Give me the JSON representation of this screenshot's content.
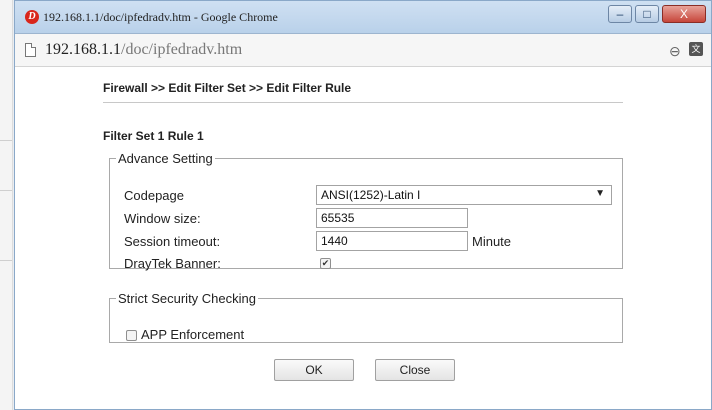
{
  "window": {
    "title": "192.168.1.1/doc/ipfedradv.htm - Google Chrome",
    "logo_letter": "D",
    "minimize": "–",
    "maximize": "□",
    "close": "X"
  },
  "address": {
    "host": "192.168.1.1",
    "path": "/doc/ipfedradv.htm"
  },
  "page": {
    "breadcrumb": "Firewall >> Edit Filter Set >> Edit Filter Rule",
    "set_title": "Filter Set 1 Rule 1"
  },
  "advance": {
    "legend": "Advance Setting",
    "codepage_label": "Codepage",
    "codepage_value": "ANSI(1252)-Latin I",
    "window_size_label": "Window size:",
    "window_size_value": "65535",
    "session_timeout_label": "Session timeout:",
    "session_timeout_value": "1440",
    "session_timeout_unit": "Minute",
    "banner_label": "DrayTek Banner:",
    "banner_checked": true
  },
  "strict": {
    "legend": "Strict Security Checking",
    "app_enforcement_label": "APP Enforcement",
    "app_enforcement_checked": false
  },
  "buttons": {
    "ok": "OK",
    "close": "Close"
  },
  "icons": {
    "zoom": "magnifier-minus-icon",
    "translate": "translate-icon",
    "page": "document-icon"
  }
}
